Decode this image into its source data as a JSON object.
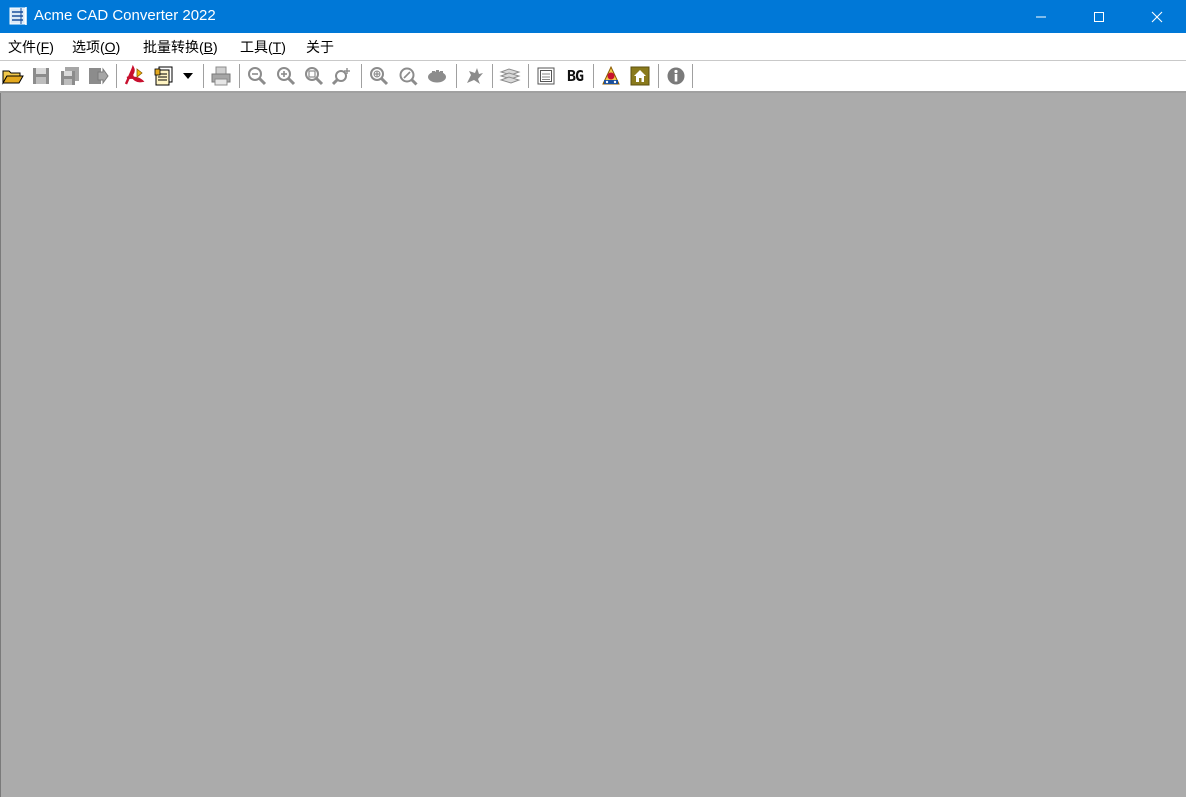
{
  "window": {
    "title": "Acme CAD Converter 2022",
    "accent_color": "#0078d7",
    "workspace_color": "#ababab"
  },
  "titlebar_controls": {
    "minimize_icon": "minimize-icon",
    "maximize_icon": "maximize-icon",
    "close_icon": "close-icon"
  },
  "menu": {
    "file": {
      "text": "文件(",
      "mnemonic": "F",
      "close": ")"
    },
    "options": {
      "text": "选项(",
      "mnemonic": "O",
      "close": ")"
    },
    "batch": {
      "text": "批量转换(",
      "mnemonic": "B",
      "close": ")"
    },
    "tools": {
      "text": "工具(",
      "mnemonic": "T",
      "close": ")"
    },
    "about": {
      "text": "关于"
    }
  },
  "toolbar": {
    "bg_label": "BG",
    "icons": [
      "open-folder-icon",
      "save-icon",
      "save-all-icon",
      "export-icon",
      "convert-pdf-icon",
      "convert-format-icon",
      "dropdown-arrow-icon",
      "print-icon",
      "zoom-out-icon",
      "zoom-in-icon",
      "zoom-window-icon",
      "zoom-realtime-icon",
      "zoom-extents-icon",
      "magnify-icon",
      "pan-icon",
      "redraw-icon",
      "layers-icon",
      "black-background-icon",
      "bg-color-icon",
      "help-icon",
      "home-icon",
      "info-icon"
    ]
  }
}
